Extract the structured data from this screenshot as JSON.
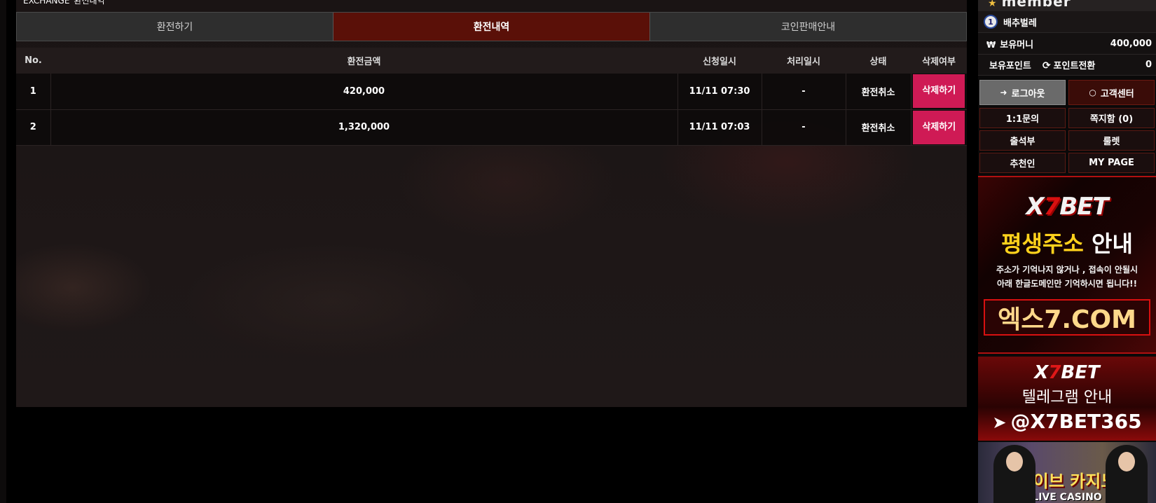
{
  "header": {
    "title_en": "EXCHANGE",
    "title_ko": "환전내역"
  },
  "tabs": [
    {
      "label": "환전하기",
      "active": false
    },
    {
      "label": "환전내역",
      "active": true
    },
    {
      "label": "코인판매안내",
      "active": false
    }
  ],
  "table": {
    "columns": [
      "No.",
      "환전금액",
      "신청일시",
      "처리일시",
      "상태",
      "삭제여부"
    ],
    "rows": [
      {
        "no": "1",
        "amount": "420,000",
        "requested": "11/11 07:30",
        "processed": "-",
        "status": "환전취소",
        "action": "삭제하기"
      },
      {
        "no": "2",
        "amount": "1,320,000",
        "requested": "11/11 07:03",
        "processed": "-",
        "status": "환전취소",
        "action": "삭제하기"
      }
    ]
  },
  "sidebar": {
    "heading": "member",
    "user": {
      "level": "1",
      "name": "배추벌레"
    },
    "money": {
      "label": "보유머니",
      "value": "400,000"
    },
    "points": {
      "label": "보유포인트",
      "convert_label": "포인트전환",
      "value": "0"
    },
    "logout_label": "로그아웃",
    "support_label": "고객센터",
    "menu": [
      "1:1문의",
      "쪽지함 (0)",
      "출석부",
      "룰렛",
      "추천인",
      "MY PAGE"
    ]
  },
  "banners": {
    "b1": {
      "logo_a": "X",
      "logo_b": "7",
      "logo_c": "BET",
      "title_a": "평생주소",
      "title_b": "안내",
      "desc1": "주소가 기억나지 않거나 , 접속이 안될시",
      "desc2": "아래 한글도메인만 기억하시면 됩니다!!",
      "domain": "엑스7.COM"
    },
    "b2": {
      "logo_a": "X",
      "logo_b": "7",
      "logo_c": "BET",
      "title": "텔레그램 안내",
      "handle": "@X7BET365"
    },
    "b3": {
      "title": "라이브 카지노",
      "subtitle": "LIVE CASINO"
    }
  },
  "colors": {
    "active_tab": "#5a1008",
    "delete_button": "#cf1a55",
    "accent_red": "#d81010",
    "accent_yellow": "#ffd21c"
  }
}
